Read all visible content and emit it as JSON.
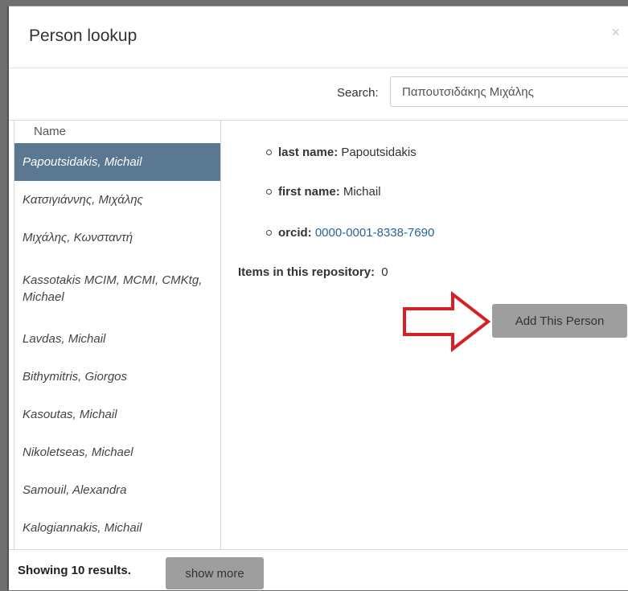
{
  "dialog": {
    "title": "Person lookup",
    "close_glyph": "×"
  },
  "search": {
    "label": "Search:",
    "value": "Παπουτσιδάκης Μιχάλης"
  },
  "list": {
    "header": "Name",
    "items": [
      "Papoutsidakis, Michail",
      "Κατσιγιάννης, Μιχάλης",
      "Μιχάλης, Κωνσταντή",
      "Kassotakis MCIM, MCMI, CMKtg, Michael",
      "Lavdas, Michail",
      "Bithymitris, Giorgos",
      "Kasoutas, Michail",
      "Nikoletseas, Michael",
      "Samouil, Alexandra",
      "Kalogiannakis, Michail"
    ],
    "selected_index": 0
  },
  "detail": {
    "last_name_label": "last name:",
    "last_name_value": "Papoutsidakis",
    "first_name_label": "first name:",
    "first_name_value": "Michail",
    "orcid_label": "orcid:",
    "orcid_value": "0000-0001-8338-7690",
    "items_label": "Items in this repository:",
    "items_value": "0",
    "add_button": "Add This Person"
  },
  "footer": {
    "showing": "Showing 10 results.",
    "show_more": "show more"
  },
  "colors": {
    "selected_row": "#5a7891",
    "button_bg": "#9e9e9e",
    "arrow": "#d71f27",
    "link": "#2a6496"
  }
}
